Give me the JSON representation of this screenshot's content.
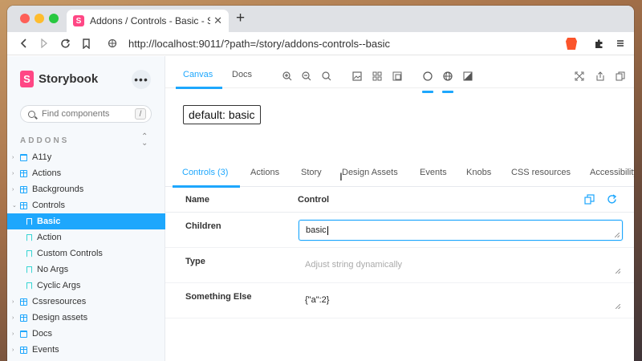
{
  "browser": {
    "tab_title": "Addons / Controls - Basic - Sto",
    "new_tab": "+",
    "url": "http://localhost:9011/?path=/story/addons-controls--basic"
  },
  "sidebar": {
    "brand": "Storybook",
    "search_placeholder": "Find components",
    "search_shortcut": "/",
    "section_label": "ADDONS",
    "items": [
      {
        "label": "A11y",
        "type": "component",
        "caret": "›"
      },
      {
        "label": "Actions",
        "type": "component",
        "caret": "›"
      },
      {
        "label": "Backgrounds",
        "type": "component",
        "caret": "›"
      },
      {
        "label": "Controls",
        "type": "component",
        "caret": "⌄"
      },
      {
        "label": "Basic",
        "type": "story",
        "caret": ""
      },
      {
        "label": "Action",
        "type": "story",
        "caret": ""
      },
      {
        "label": "Custom Controls",
        "type": "story",
        "caret": ""
      },
      {
        "label": "No Args",
        "type": "story",
        "caret": ""
      },
      {
        "label": "Cyclic Args",
        "type": "story",
        "caret": ""
      },
      {
        "label": "Cssresources",
        "type": "component",
        "caret": "›"
      },
      {
        "label": "Design assets",
        "type": "component",
        "caret": "›"
      },
      {
        "label": "Docs",
        "type": "folder",
        "caret": "›"
      },
      {
        "label": "Events",
        "type": "component",
        "caret": "›"
      }
    ],
    "selected_item": "Basic"
  },
  "toolbar": {
    "tabs": [
      "Canvas",
      "Docs"
    ],
    "active_tab": "Canvas",
    "icons": [
      "zoom-in-icon",
      "zoom-out-icon",
      "zoom-reset-icon",
      "background-icon",
      "grid-icon",
      "outline-icon",
      "circle-icon",
      "globe-icon",
      "contrast-icon",
      "fullscreen-icon",
      "share-icon",
      "copy-link-icon"
    ]
  },
  "preview": {
    "button_label": "default: basic"
  },
  "addons": {
    "tabs": [
      "Controls (3)",
      "Actions",
      "Story",
      "Design Assets",
      "Events",
      "Knobs",
      "CSS resources",
      "Accessibility"
    ],
    "active_tab": "Controls (3)"
  },
  "controls": {
    "col_name": "Name",
    "col_control": "Control",
    "rows": [
      {
        "name": "Children",
        "value": "basic",
        "placeholder": ""
      },
      {
        "name": "Type",
        "value": "",
        "placeholder": "Adjust string dynamically"
      },
      {
        "name": "Something Else",
        "value": "{\"a\":2}",
        "placeholder": ""
      }
    ]
  },
  "colors": {
    "accent": "#1ea7fd",
    "brand": "#ff4785"
  }
}
